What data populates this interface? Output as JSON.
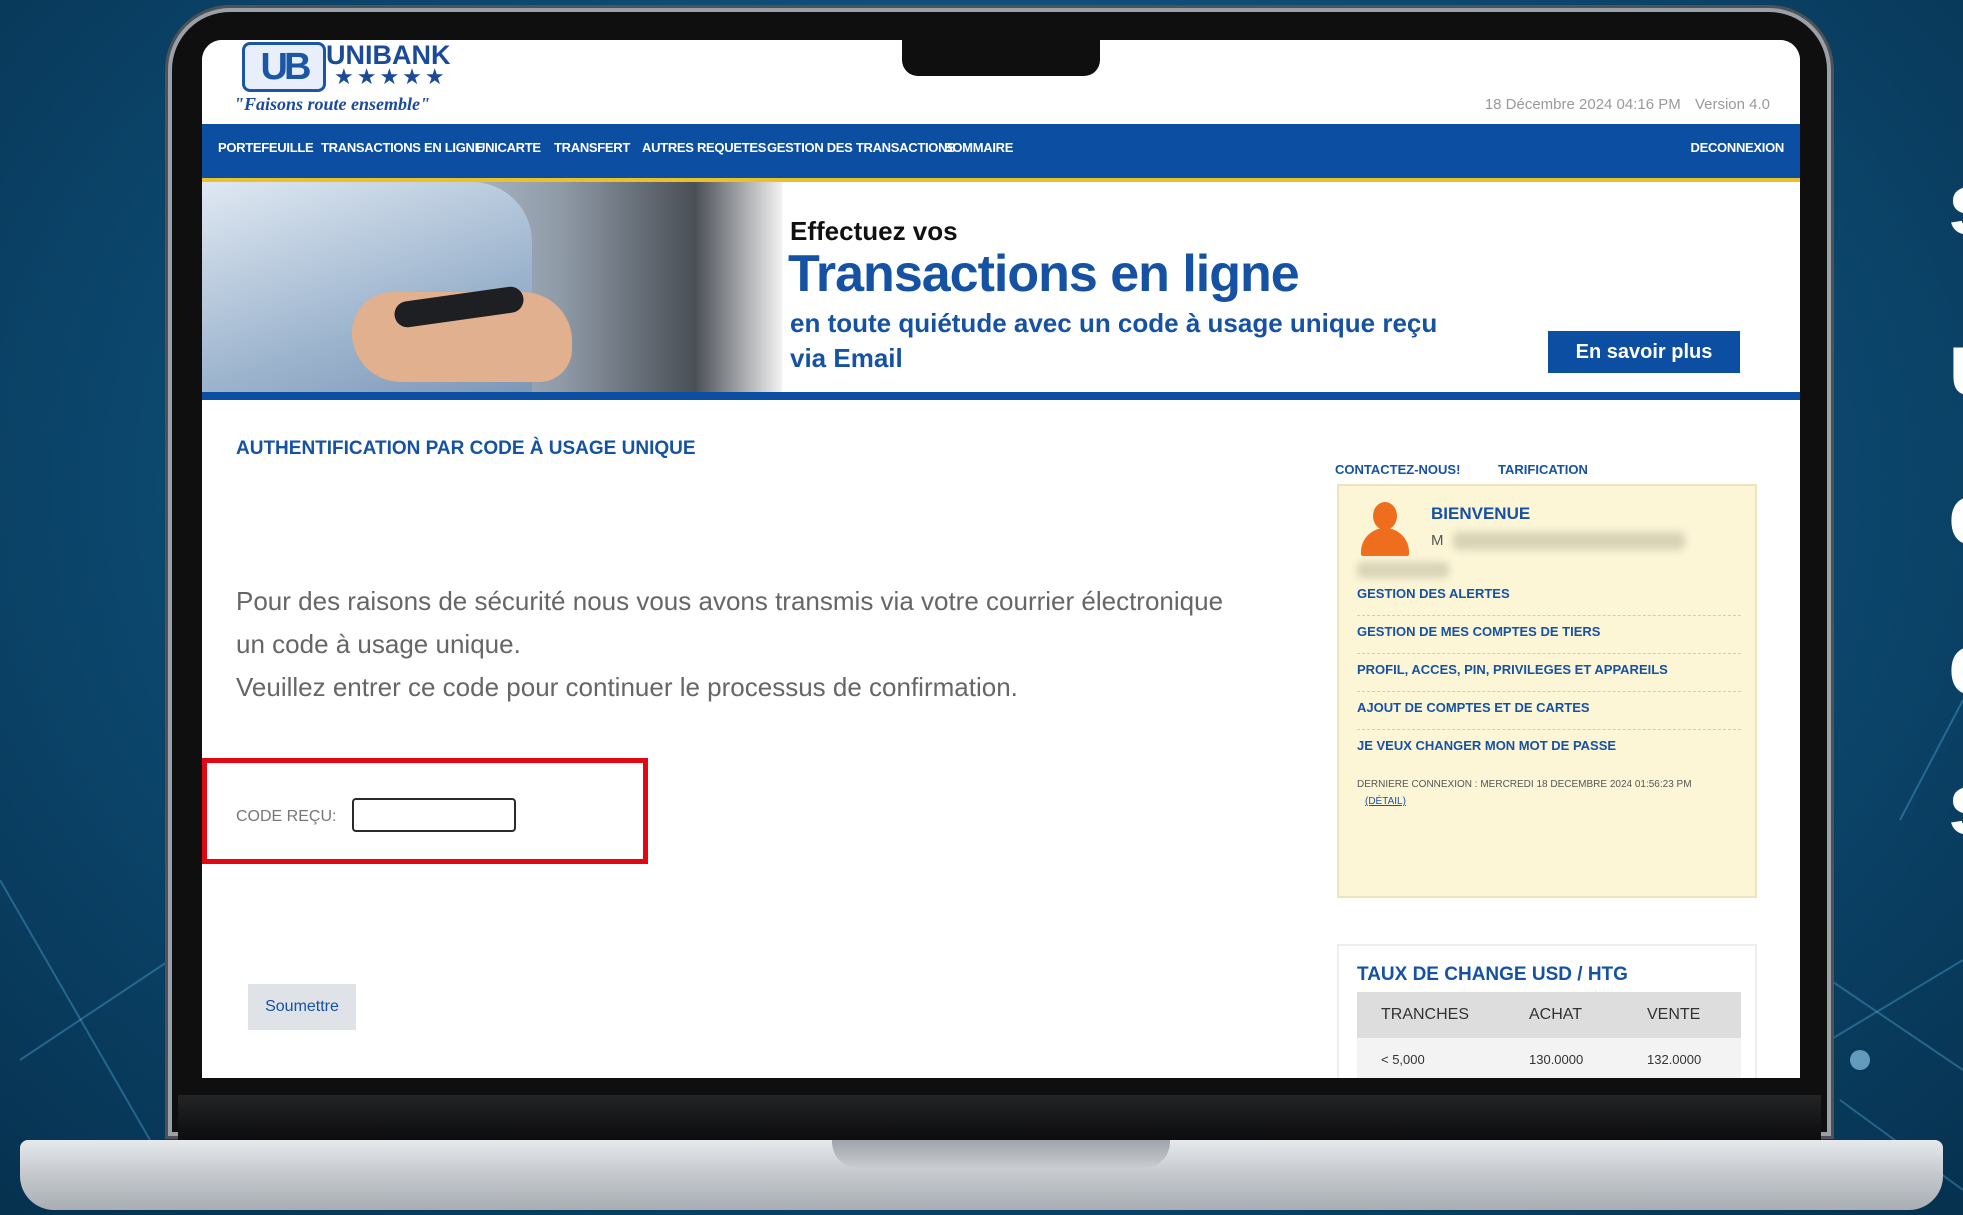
{
  "bank": {
    "logo_mark": "UB",
    "name": "UNIBANK",
    "stars": "★★★★★",
    "slogan": "\"Faisons route ensemble\""
  },
  "header": {
    "datetime": "18 Décembre 2024 04:16 PM",
    "version": "Version 4.0"
  },
  "nav": {
    "items": [
      "PORTEFEUILLE",
      "TRANSACTIONS EN LIGNE",
      "UNICARTE",
      "TRANSFERT",
      "AUTRES REQUETES",
      "GESTION DES TRANSACTIONS",
      "SOMMAIRE"
    ],
    "logout": "DECONNEXION"
  },
  "banner": {
    "line1": "Effectuez vos",
    "line2": "Transactions en ligne",
    "line3": "en toute quiétude avec un code à usage unique reçu via Email",
    "button": "En savoir plus"
  },
  "main": {
    "title": "AUTHENTIFICATION PAR CODE À USAGE UNIQUE",
    "message_1": "Pour des raisons de sécurité nous vous avons transmis via votre courrier électronique un code à usage unique.",
    "message_2": "Veuillez entrer ce code pour continuer le processus de confirmation.",
    "code_label": "CODE REÇU:",
    "code_value": "",
    "submit": "Soumettre"
  },
  "sidebar": {
    "links": [
      "CONTACTEZ-NOUS!",
      "TARIFICATION"
    ],
    "welcome_title": "BIENVENUE",
    "welcome_name_initial": "M",
    "menu": [
      "GESTION DES ALERTES",
      "GESTION DE MES COMPTES DE TIERS",
      "PROFIL, ACCES, PIN, PRIVILEGES ET APPAREILS",
      "AJOUT DE COMPTES ET DE CARTES",
      "JE VEUX CHANGER MON MOT DE PASSE"
    ],
    "last_connection": "DERNIERE CONNEXION : MERCREDI 18 DECEMBRE 2024 01:56:23 PM",
    "detail_link": "(DÉTAIL)"
  },
  "rates": {
    "title": "TAUX DE CHANGE USD / HTG",
    "columns": [
      "TRANCHES",
      "ACHAT",
      "VENTE"
    ],
    "rows": [
      [
        "< 5,000",
        "130.0000",
        "132.0000"
      ]
    ]
  },
  "side_glyphs": [
    "s",
    "u",
    "e",
    "e",
    "s"
  ],
  "colors": {
    "brand_blue": "#0c4ea2",
    "accent_yellow": "#e9c12a",
    "highlight_red": "#e30613"
  }
}
